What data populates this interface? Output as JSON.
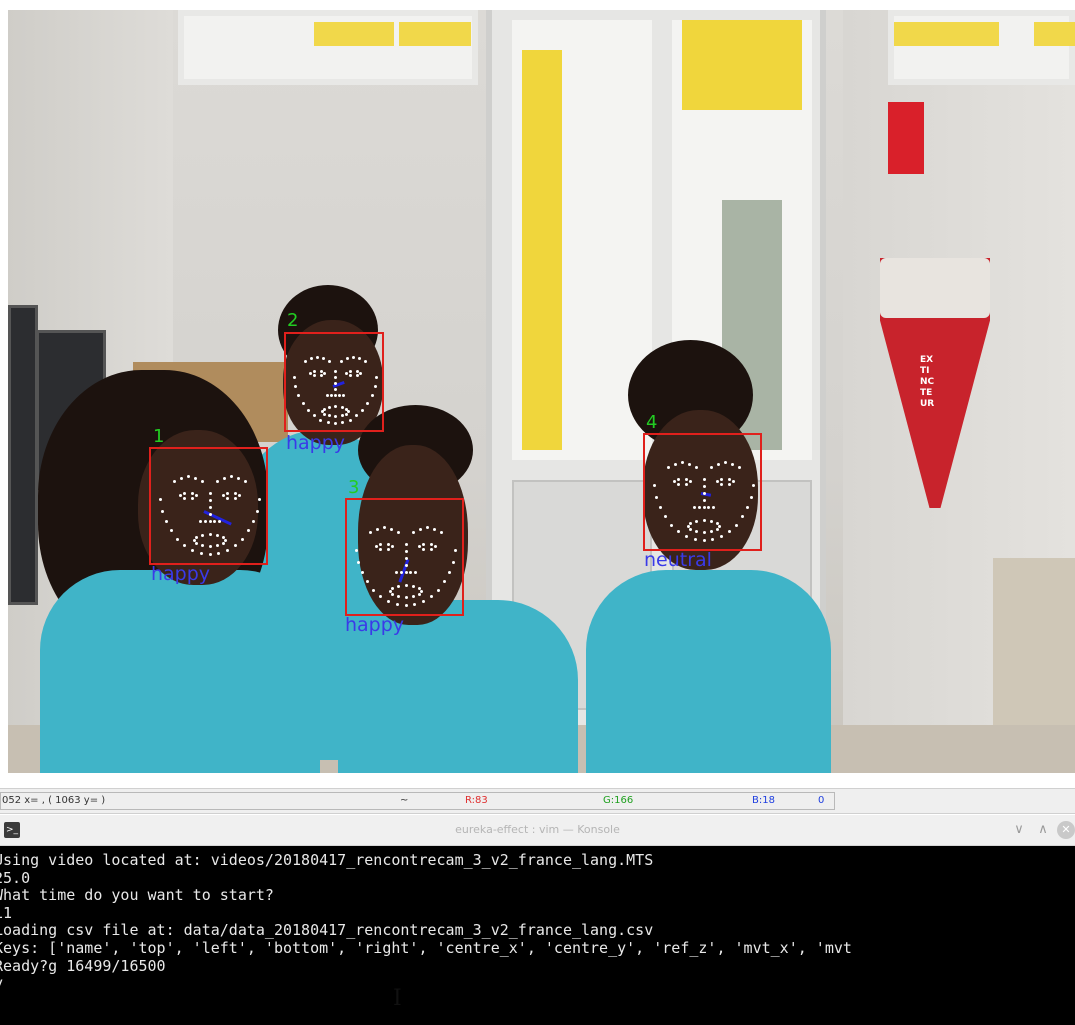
{
  "video": {
    "faces": [
      {
        "id": "1",
        "emotion": "happy"
      },
      {
        "id": "2",
        "emotion": "happy"
      },
      {
        "id": "3",
        "emotion": "happy"
      },
      {
        "id": "4",
        "emotion": "neutral"
      }
    ],
    "wall_sign": "EXTINCTEUR"
  },
  "status_bar": {
    "coords": "052  x=  ,  (          1063  y=  )",
    "tilde": "~",
    "r": "R:83",
    "g": "G:166",
    "b": "B:18",
    "a": "0"
  },
  "window": {
    "title": "eureka-effect : vim — Konsole",
    "app_icon_glyph": ">_",
    "minimize_glyph": "∨",
    "maximize_glyph": "∧",
    "close_glyph": "✕"
  },
  "terminal": {
    "lines": [
      "Using video located at: videos/20180417_rencontrecam_3_v2_france_lang.MTS",
      "25.0",
      "What time do you want to start?",
      "11",
      "Loading csv file at: data/data_20180417_rencontrecam_3_v2_france_lang.csv",
      "Keys: ['name', 'top', 'left', 'bottom', 'right', 'centre_x', 'centre_y', 'ref_z', 'mvt_x', 'mvt",
      "Ready?g 16499/16500",
      "y"
    ]
  },
  "colors": {
    "face_box": "#e0201c",
    "face_id": "#22cc22",
    "emotion_label": "#3a3ae8",
    "terminal_bg": "#000000",
    "terminal_fg": "#e8e8e8",
    "status_r": "#e03030",
    "status_g": "#20a020",
    "status_b": "#2040e0"
  }
}
